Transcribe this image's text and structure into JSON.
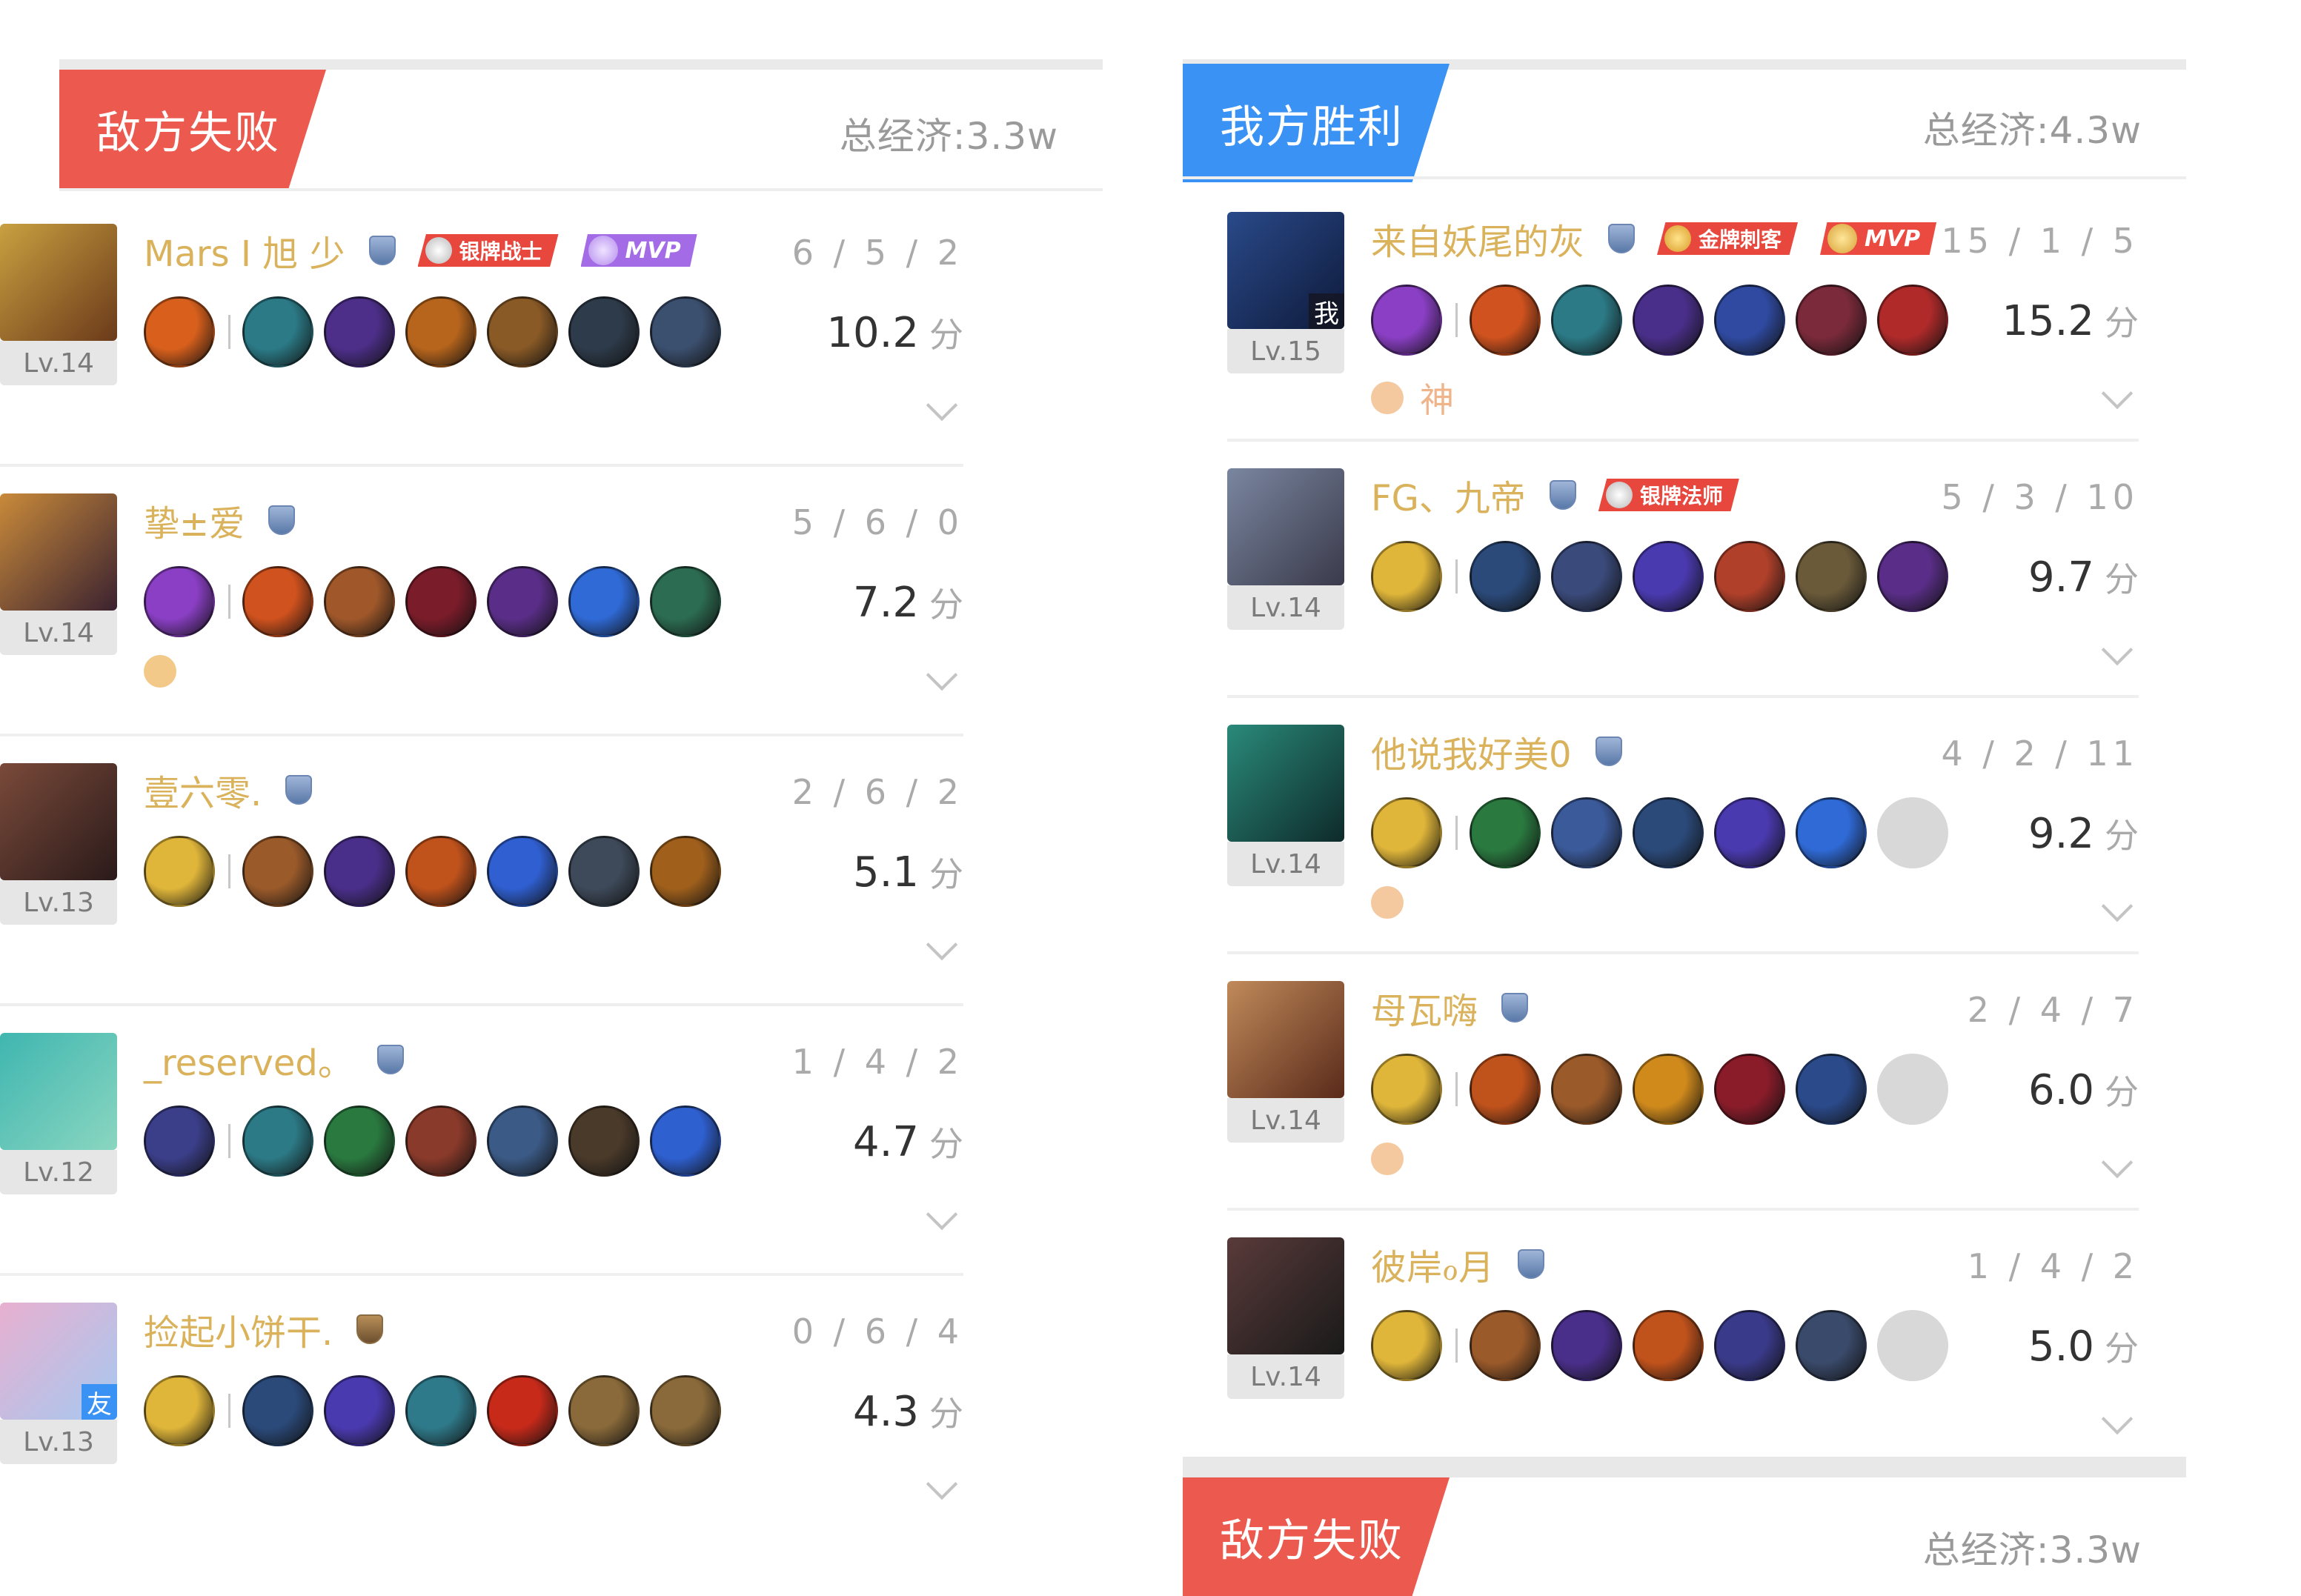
{
  "left_team": {
    "result_label": "敌方失败",
    "economy_label": "总经济:3.3w",
    "players": [
      {
        "name": "Mars I 旭 少",
        "level": "Lv.14",
        "kda": "6 / 5 / 2",
        "score": "10.2",
        "unit": "分",
        "medal": "银牌战士",
        "medal_type": "silver",
        "mvp": "MVP",
        "mvp_type": "purple",
        "rank": "silver",
        "avatar_colors": [
          "#c9a040",
          "#6b3a1a"
        ],
        "items": [
          "#d8601c",
          "#2b7a86",
          "#4d2f8a",
          "#b7651c",
          "#8a5a26",
          "#2e3b4a",
          "#3b4f6e"
        ],
        "empty_slots": 0,
        "extra_icon": "",
        "extra_text": ""
      },
      {
        "name": "挚±爱",
        "level": "Lv.14",
        "kda": "5 / 6 / 0",
        "score": "7.2",
        "unit": "分",
        "medal": "",
        "mvp": "",
        "rank": "silver",
        "avatar_colors": [
          "#c98a3a",
          "#3b2230"
        ],
        "items": [
          "#8a3fc4",
          "#d0521e",
          "#a0582a",
          "#7b1c2a",
          "#5a2e88",
          "#2f6ad6",
          "#2c6c52"
        ],
        "empty_slots": 0,
        "extra_icon": "shield-coin-icon",
        "extra_text": ""
      },
      {
        "name": "壹六零.",
        "level": "Lv.13",
        "kda": "2 / 6 / 2",
        "score": "5.1",
        "unit": "分",
        "medal": "",
        "mvp": "",
        "rank": "silver",
        "avatar_colors": [
          "#7a4a3a",
          "#2a1a1a"
        ],
        "items": [
          "#e0b63a",
          "#9a5a2a",
          "#4a2f8a",
          "#c0521c",
          "#2f5fd0",
          "#3e4a5a",
          "#a0601c"
        ],
        "empty_slots": 0,
        "extra_icon": "",
        "extra_text": ""
      },
      {
        "name": "_reserved。",
        "level": "Lv.12",
        "kda": "1 / 4 / 2",
        "score": "4.7",
        "unit": "分",
        "medal": "",
        "mvp": "",
        "rank": "silver",
        "avatar_colors": [
          "#3fb6b0",
          "#8ad6c0"
        ],
        "items": [
          "#3b3f8a",
          "#2c7a86",
          "#2a7a40",
          "#8a3a2a",
          "#3b5a86",
          "#4a3a2a",
          "#2f60d0"
        ],
        "empty_slots": 0,
        "extra_icon": "",
        "extra_text": ""
      },
      {
        "name": "捡起小饼干.",
        "level": "Lv.13",
        "kda": "0 / 6 / 4",
        "score": "4.3",
        "unit": "分",
        "medal": "",
        "mvp": "",
        "rank": "bronze",
        "avatar_colors": [
          "#e8b0d0",
          "#a6c8f0"
        ],
        "avatar_badge": "友",
        "items": [
          "#e0b63a",
          "#2b4a7a",
          "#4a3ab0",
          "#2f7a8a",
          "#c82a1a",
          "#8a6a3a",
          "#8a6a3a"
        ],
        "empty_slots": 0,
        "extra_icon": "",
        "extra_text": ""
      }
    ]
  },
  "right_team": {
    "result_label": "我方胜利",
    "economy_label": "总经济:4.3w",
    "players": [
      {
        "name": "来自妖尾的灰",
        "level": "Lv.15",
        "kda": "15 / 1 / 5",
        "score": "15.2",
        "unit": "分",
        "medal": "金牌刺客",
        "medal_type": "gold",
        "mvp": "MVP",
        "mvp_type": "red",
        "rank": "silver",
        "avatar_colors": [
          "#2a4a8a",
          "#0e1a3a"
        ],
        "avatar_badge": "我",
        "items": [
          "#8a3fc4",
          "#d0521e",
          "#2c7a86",
          "#4a2f8a",
          "#2f4aa0",
          "#7a2a3a",
          "#b02a2a"
        ],
        "empty_slots": 0,
        "extra_icon": "flame-icon",
        "extra_text": "神"
      },
      {
        "name": "FG、九帝",
        "level": "Lv.14",
        "kda": "5 / 3 / 10",
        "score": "9.7",
        "unit": "分",
        "medal": "银牌法师",
        "medal_type": "silver",
        "mvp": "",
        "rank": "silver",
        "avatar_colors": [
          "#7a86a0",
          "#3a3a4a"
        ],
        "items": [
          "#e0b63a",
          "#2b4a7a",
          "#3a4a7a",
          "#4a3ab0",
          "#b0402a",
          "#6a5a3a",
          "#5a2e88"
        ],
        "empty_slots": 0,
        "extra_icon": "",
        "extra_text": ""
      },
      {
        "name": "他说我好美0",
        "level": "Lv.14",
        "kda": "4 / 2 / 11",
        "score": "9.2",
        "unit": "分",
        "medal": "",
        "mvp": "",
        "rank": "silver",
        "avatar_colors": [
          "#2a8a7a",
          "#0e2a2a"
        ],
        "items": [
          "#e0b63a",
          "#2a7a40",
          "#3b5a9a",
          "#2b4a7a",
          "#4a3ab0",
          "#2f6ad6"
        ],
        "empty_slots": 1,
        "extra_icon": "fist-icon",
        "extra_text": ""
      },
      {
        "name": "母瓦嗨",
        "level": "Lv.14",
        "kda": "2 / 4 / 7",
        "score": "6.0",
        "unit": "分",
        "medal": "",
        "mvp": "",
        "rank": "silver",
        "avatar_colors": [
          "#c08a5a",
          "#5a2a1a"
        ],
        "items": [
          "#e0b63a",
          "#c0521c",
          "#9a5a2a",
          "#d08a1c",
          "#8a1c2a",
          "#2b4a8a"
        ],
        "empty_slots": 1,
        "extra_icon": "tower-icon",
        "extra_text": ""
      },
      {
        "name": "彼岸ℴ月",
        "level": "Lv.14",
        "kda": "1 / 4 / 2",
        "score": "5.0",
        "unit": "分",
        "medal": "",
        "mvp": "",
        "rank": "silver",
        "avatar_colors": [
          "#5a3a3a",
          "#1a1a1a"
        ],
        "items": [
          "#e0b63a",
          "#9a5a2a",
          "#4a2f8a",
          "#c0521c",
          "#3a3a8a",
          "#3a4a6a"
        ],
        "empty_slots": 1,
        "extra_icon": "",
        "extra_text": ""
      }
    ]
  },
  "next_section": {
    "result_label": "敌方失败",
    "economy_label": "总经济:3.3w"
  }
}
